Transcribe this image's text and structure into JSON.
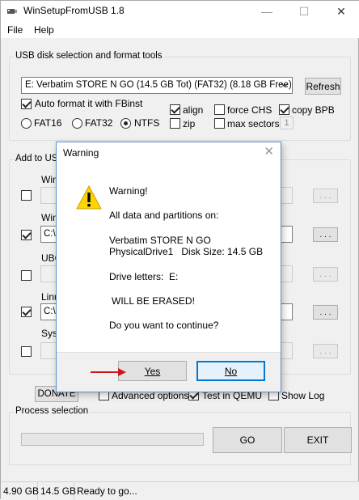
{
  "window": {
    "title": "WinSetupFromUSB 1.8",
    "minimize": "—",
    "maximize": "☐",
    "close": "✕"
  },
  "menu": {
    "file": "File",
    "help": "Help"
  },
  "usb_group": {
    "label": "USB disk selection and format tools",
    "disk": "E: Verbatim STORE N GO (14.5 GB Tot) (FAT32) (8.18 GB Free)",
    "refresh": "Refresh",
    "auto_format": "Auto format it with FBinst",
    "align": "align",
    "force_chs": "force CHS",
    "copy_bpb": "copy BPB",
    "zip": "zip",
    "max_sectors": "max sectors",
    "max_sectors_value": "1",
    "fat16": "FAT16",
    "fat32": "FAT32",
    "ntfs": "NTFS"
  },
  "add_group": {
    "label": "Add to USB",
    "row1_label": "Wind",
    "row2_label": "Wind",
    "row2_path": "C:\\",
    "row3_label": "UBC",
    "row4_label": "Linu",
    "row4_path": "C:\\",
    "row5_label": "SysL",
    "browse": ". . ."
  },
  "bottom": {
    "donate": "DONATE",
    "advanced": "Advanced options",
    "test_qemu": "Test in QEMU",
    "show_log": "Show Log",
    "process_label": "Process selection",
    "go": "GO",
    "exit": "EXIT"
  },
  "status": {
    "size1": "4.90 GB",
    "size2": "14.5 GB",
    "message": "Ready to go..."
  },
  "dialog": {
    "title": "Warning",
    "close": "✕",
    "icon": "warning-triangle-icon",
    "line1": "Warning!",
    "line2": "All data and partitions on:",
    "line3": "Verbatim STORE N GO",
    "line4": "PhysicalDrive1   Disk Size: 14.5 GB",
    "line5": "Drive letters:  E:",
    "line6": "WILL BE ERASED!",
    "line7": "Do you want to continue?",
    "yes": "Yes",
    "no": "No"
  },
  "colors": {
    "accent": "#0078d7",
    "arrow": "#d0141b",
    "warning_yellow": "#ffd400"
  }
}
